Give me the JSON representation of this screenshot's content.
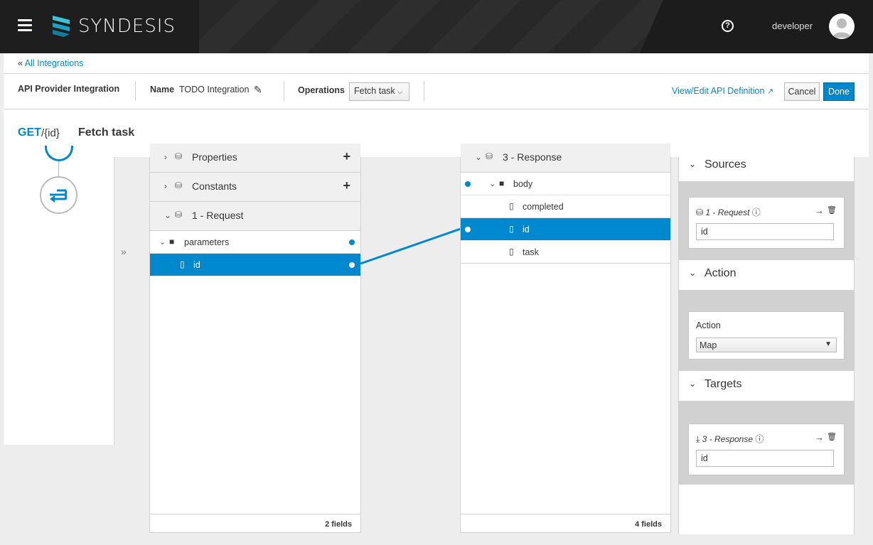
{
  "brand": {
    "name": "SYNDESIS"
  },
  "nav": {
    "user": "developer",
    "help_icon": "help-circle-icon"
  },
  "breadcrumb": {
    "prefix": "«",
    "link": "All Integrations"
  },
  "integration": {
    "type": "API Provider Integration",
    "name_label": "Name",
    "name_value": "TODO Integration",
    "operations_label": "Operations",
    "operation_selected": "Fetch task",
    "api_link": "View/Edit API Definition",
    "cancel": "Cancel",
    "done": "Done"
  },
  "operation": {
    "method": "GET",
    "path": "/{id}",
    "title": "Fetch task"
  },
  "expand_label": "»",
  "source": {
    "docs": [
      {
        "label": "Properties"
      },
      {
        "label": "Constants"
      },
      {
        "label": "1 - Request"
      }
    ],
    "fields": [
      {
        "label": "parameters"
      },
      {
        "label": "id"
      }
    ],
    "footer": "2 fields"
  },
  "target": {
    "doc": {
      "label": "3 - Response"
    },
    "fields": [
      {
        "label": "body"
      },
      {
        "label": "completed"
      },
      {
        "label": "id"
      },
      {
        "label": "task"
      }
    ],
    "footer": "4 fields"
  },
  "mapping": {
    "sources": {
      "header": "Sources",
      "doc": "1 - Request",
      "value": "id"
    },
    "action": {
      "header": "Action",
      "label": "Action",
      "selected": "Map"
    },
    "targets": {
      "header": "Targets",
      "doc": "3 - Response",
      "value": "id"
    }
  },
  "colors": {
    "accent": "#0088ce",
    "navbar": "#1e1e1e"
  }
}
